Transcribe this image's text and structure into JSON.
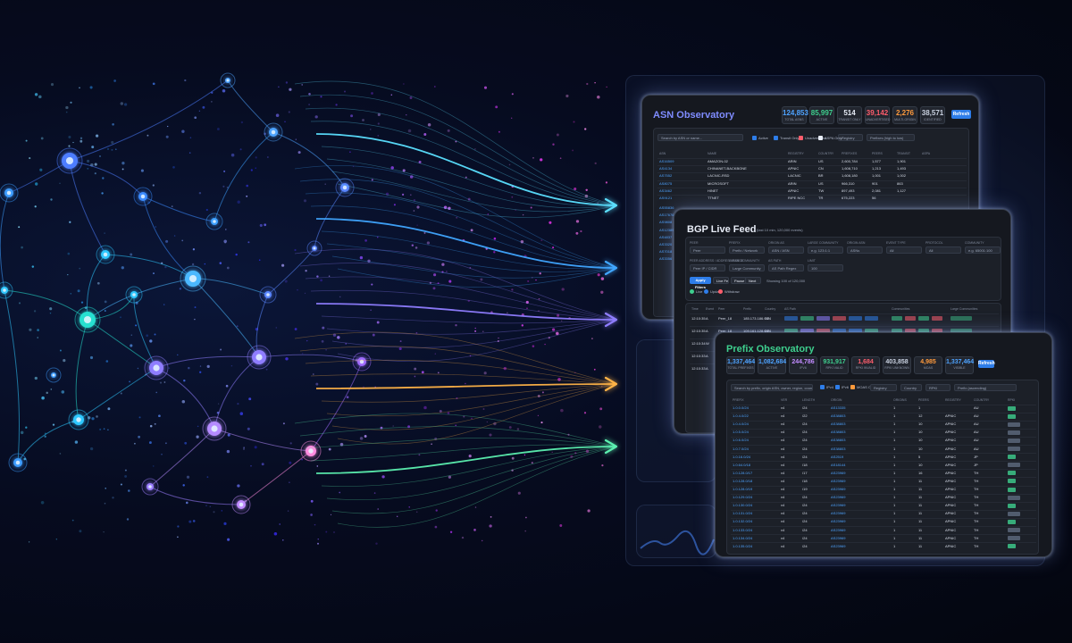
{
  "asn_panel": {
    "title": "ASN Observatory",
    "stats": [
      {
        "value": "124,853",
        "label": "TOTAL ASNS",
        "color": "#4ea3ff"
      },
      {
        "value": "85,997",
        "label": "ACTIVE",
        "color": "#3ecf8e"
      },
      {
        "value": "514",
        "label": "TRANSIT ONLY",
        "color": "#e8edf7"
      },
      {
        "value": "39,142",
        "label": "UNADVERTISED",
        "color": "#ff5d6c"
      },
      {
        "value": "2,276",
        "label": "MULTI-ORIGIN",
        "color": "#ff9a3c"
      },
      {
        "value": "38,571",
        "label": "IDENTIFIED",
        "color": "#c9d1e0"
      }
    ],
    "refresh": "Refresh",
    "search_placeholder": "Search by ASN or name...",
    "filters": [
      "Active",
      "Transit Only",
      "Unadvertised",
      "ASPA Only"
    ],
    "registry": "Registry",
    "sort": "Prefixes (high to low)",
    "columns": [
      "ASN",
      "NAME",
      "REGISTRY",
      "COUNTRY",
      "PREFIXES",
      "PEERS",
      "TRANSIT",
      "ASPA"
    ],
    "rows": [
      {
        "asn": "AS16509",
        "name": "AMAZON-02",
        "registry": "ARIN",
        "country": "US",
        "prefixes": "2,600,784",
        "peers": "1,577",
        "transit": "1,901"
      },
      {
        "asn": "AS4134",
        "name": "CHINANET-BACKBONE",
        "registry": "APNIC",
        "country": "CN",
        "prefixes": "1,608,710",
        "peers": "1,213",
        "transit": "1,493"
      },
      {
        "asn": "AS7552",
        "name": "LACNIC-RSD",
        "registry": "LACNIC",
        "country": "BR",
        "prefixes": "1,608,180",
        "peers": "1,001",
        "transit": "1,002"
      },
      {
        "asn": "AS8075",
        "name": "MICROSOFT",
        "registry": "ARIN",
        "country": "US",
        "prefixes": "966,310",
        "peers": "901",
        "transit": "863"
      },
      {
        "asn": "AS3462",
        "name": "HINET",
        "registry": "APNIC",
        "country": "TW",
        "prefixes": "897,493",
        "peers": "2,081",
        "transit": "1,127"
      },
      {
        "asn": "AS9121",
        "name": "TTNET",
        "registry": "RIPE NCC",
        "country": "TR",
        "prefixes": "675,223",
        "peers": "56",
        "transit": ""
      }
    ],
    "extra_asns": [
      "AS55836",
      "AS17676",
      "AS9808",
      "AS12389",
      "AS4837",
      "AS3320",
      "AS7018",
      "AS3356"
    ]
  },
  "bgp_panel": {
    "title": "BGP Live Feed",
    "subtitle": "(last 10 min, 120,000 events)",
    "filter_labels": [
      "PEER",
      "PREFIX",
      "ORIGIN AS",
      "LARGE COMMUNITY",
      "ORIGIN ASN",
      "EVENT TYPE",
      "PROTOCOL",
      "COMMUNITY"
    ],
    "filter_values": [
      "Peer",
      "Prefix / Network",
      "ASN / ASN",
      "e.g. 123:1:1",
      "ASNs",
      "All",
      "All",
      "e.g. 65001:100"
    ],
    "row2_labels": [
      "PEER ADDRESS / ADDRESS RANGE",
      "LARGE COMMUNITY",
      "AS PATH",
      "LIMIT"
    ],
    "row2_values": [
      "Peer IP / CIDR",
      "Large Community",
      "AS Path Regex",
      "100"
    ],
    "buttons": [
      "Apply Filters",
      "Live Feed",
      "Pause",
      "Next"
    ],
    "status": "Showing 100 of 120,000",
    "legend": [
      "Live",
      "Update",
      "Withdraw"
    ],
    "columns": [
      "Time",
      "Event",
      "Peer",
      "Prefix",
      "Country",
      "AS Path",
      "Communities",
      "Large Communities"
    ],
    "rows": [
      {
        "time": "12:10:35",
        "event": "A",
        "peer": "Peer_18",
        "prefix": "185.173.186.0/24",
        "country": "SE"
      },
      {
        "time": "12:10:35",
        "event": "A",
        "peer": "Peer_18",
        "prefix": "109.161.128.0/24",
        "country": "DE"
      },
      {
        "time": "12:10:34",
        "event": "W",
        "peer": "Peer_12",
        "prefix": "",
        "country": ""
      },
      {
        "time": "12:10:33",
        "event": "A",
        "peer": "Peer_07",
        "prefix": "",
        "country": ""
      },
      {
        "time": "12:10:33",
        "event": "A",
        "peer": "Peer_07",
        "prefix": "",
        "country": ""
      }
    ]
  },
  "prefix_panel": {
    "title": "Prefix Observatory",
    "stats": [
      {
        "value": "1,337,464",
        "label": "TOTAL PREFIXES",
        "color": "#4ea3ff"
      },
      {
        "value": "1,082,684",
        "label": "ACTIVE",
        "color": "#4ea3ff"
      },
      {
        "value": "244,786",
        "label": "IPV6",
        "color": "#c28bff"
      },
      {
        "value": "931,917",
        "label": "RPKI VALID",
        "color": "#3ecf8e"
      },
      {
        "value": "1,684",
        "label": "RPKI INVALID",
        "color": "#ff5d6c"
      },
      {
        "value": "403,858",
        "label": "RPKI UNKNOWN",
        "color": "#c9d1e0"
      },
      {
        "value": "4,985",
        "label": "MOAS",
        "color": "#ff9a3c"
      },
      {
        "value": "1,337,464",
        "label": "VISIBLE",
        "color": "#4ea3ff"
      }
    ],
    "refresh": "Refresh",
    "search_placeholder": "Search by prefix, origin ASN, owner, region, country...",
    "filters": [
      "IPv4",
      "IPv6",
      "MOAS Only"
    ],
    "selects": [
      "Registry",
      "Country",
      "RPKI",
      "Prefix (ascending)"
    ],
    "columns": [
      "PREFIX",
      "VER",
      "LENGTH",
      "ORIGIN",
      "ORIGINS",
      "PEERS",
      "REGISTRY",
      "COUNTRY",
      "RPKI"
    ],
    "rows": [
      {
        "prefix": "1.0.0.0/24",
        "ver": "v4",
        "len": "/24",
        "origin": "AS13335",
        "origins": "1",
        "peers": "1",
        "registry": "",
        "country": "AU",
        "rpki": "valid"
      },
      {
        "prefix": "1.0.4.0/22",
        "ver": "v4",
        "len": "/22",
        "origin": "AS38803",
        "origins": "1",
        "peers": "12",
        "registry": "APNIC",
        "country": "AU",
        "rpki": "valid"
      },
      {
        "prefix": "1.0.4.0/24",
        "ver": "v4",
        "len": "/24",
        "origin": "AS38803",
        "origins": "1",
        "peers": "10",
        "registry": "APNIC",
        "country": "AU",
        "rpki": "unknown"
      },
      {
        "prefix": "1.0.5.0/24",
        "ver": "v4",
        "len": "/24",
        "origin": "AS38803",
        "origins": "1",
        "peers": "10",
        "registry": "APNIC",
        "country": "AU",
        "rpki": "unknown"
      },
      {
        "prefix": "1.0.6.0/24",
        "ver": "v4",
        "len": "/24",
        "origin": "AS38803",
        "origins": "1",
        "peers": "10",
        "registry": "APNIC",
        "country": "AU",
        "rpki": "unknown"
      },
      {
        "prefix": "1.0.7.0/24",
        "ver": "v4",
        "len": "/24",
        "origin": "AS38803",
        "origins": "1",
        "peers": "10",
        "registry": "APNIC",
        "country": "AU",
        "rpki": "unknown"
      },
      {
        "prefix": "1.0.16.0/24",
        "ver": "v4",
        "len": "/24",
        "origin": "AS2519",
        "origins": "1",
        "peers": "5",
        "registry": "APNIC",
        "country": "JP",
        "rpki": "valid"
      },
      {
        "prefix": "1.0.64.0/18",
        "ver": "v4",
        "len": "/18",
        "origin": "AS18144",
        "origins": "1",
        "peers": "10",
        "registry": "APNIC",
        "country": "JP",
        "rpki": "unknown"
      },
      {
        "prefix": "1.0.128.0/17",
        "ver": "v4",
        "len": "/17",
        "origin": "AS23969",
        "origins": "1",
        "peers": "16",
        "registry": "APNIC",
        "country": "TH",
        "rpki": "valid"
      },
      {
        "prefix": "1.0.128.0/18",
        "ver": "v4",
        "len": "/18",
        "origin": "AS23969",
        "origins": "1",
        "peers": "11",
        "registry": "APNIC",
        "country": "TH",
        "rpki": "valid"
      },
      {
        "prefix": "1.0.128.0/19",
        "ver": "v4",
        "len": "/19",
        "origin": "AS23969",
        "origins": "1",
        "peers": "11",
        "registry": "APNIC",
        "country": "TH",
        "rpki": "valid"
      },
      {
        "prefix": "1.0.129.0/24",
        "ver": "v4",
        "len": "/24",
        "origin": "AS23969",
        "origins": "1",
        "peers": "11",
        "registry": "APNIC",
        "country": "TH",
        "rpki": "unknown"
      },
      {
        "prefix": "1.0.130.0/24",
        "ver": "v4",
        "len": "/24",
        "origin": "AS23969",
        "origins": "1",
        "peers": "11",
        "registry": "APNIC",
        "country": "TH",
        "rpki": "valid"
      },
      {
        "prefix": "1.0.131.0/24",
        "ver": "v4",
        "len": "/24",
        "origin": "AS23969",
        "origins": "1",
        "peers": "11",
        "registry": "APNIC",
        "country": "TH",
        "rpki": "unknown"
      },
      {
        "prefix": "1.0.132.0/24",
        "ver": "v4",
        "len": "/24",
        "origin": "AS23969",
        "origins": "1",
        "peers": "11",
        "registry": "APNIC",
        "country": "TH",
        "rpki": "valid"
      },
      {
        "prefix": "1.0.133.0/24",
        "ver": "v4",
        "len": "/24",
        "origin": "AS23969",
        "origins": "1",
        "peers": "11",
        "registry": "APNIC",
        "country": "TH",
        "rpki": "unknown"
      },
      {
        "prefix": "1.0.134.0/24",
        "ver": "v4",
        "len": "/24",
        "origin": "AS23969",
        "origins": "1",
        "peers": "11",
        "registry": "APNIC",
        "country": "TH",
        "rpki": "unknown"
      },
      {
        "prefix": "1.0.135.0/24",
        "ver": "v4",
        "len": "/24",
        "origin": "AS23969",
        "origins": "1",
        "peers": "11",
        "registry": "APNIC",
        "country": "TH",
        "rpki": "valid"
      }
    ]
  },
  "colors": {
    "accent": "#2e7de9",
    "link": "#4ea3ff",
    "valid": "#3ecf8e",
    "invalid": "#ff5d6c",
    "unknown": "#5f6b80"
  },
  "arrow_colors": [
    "#5be0ff",
    "#40a6ff",
    "#8f7dff",
    "#ffb347",
    "#5cf0b0"
  ]
}
